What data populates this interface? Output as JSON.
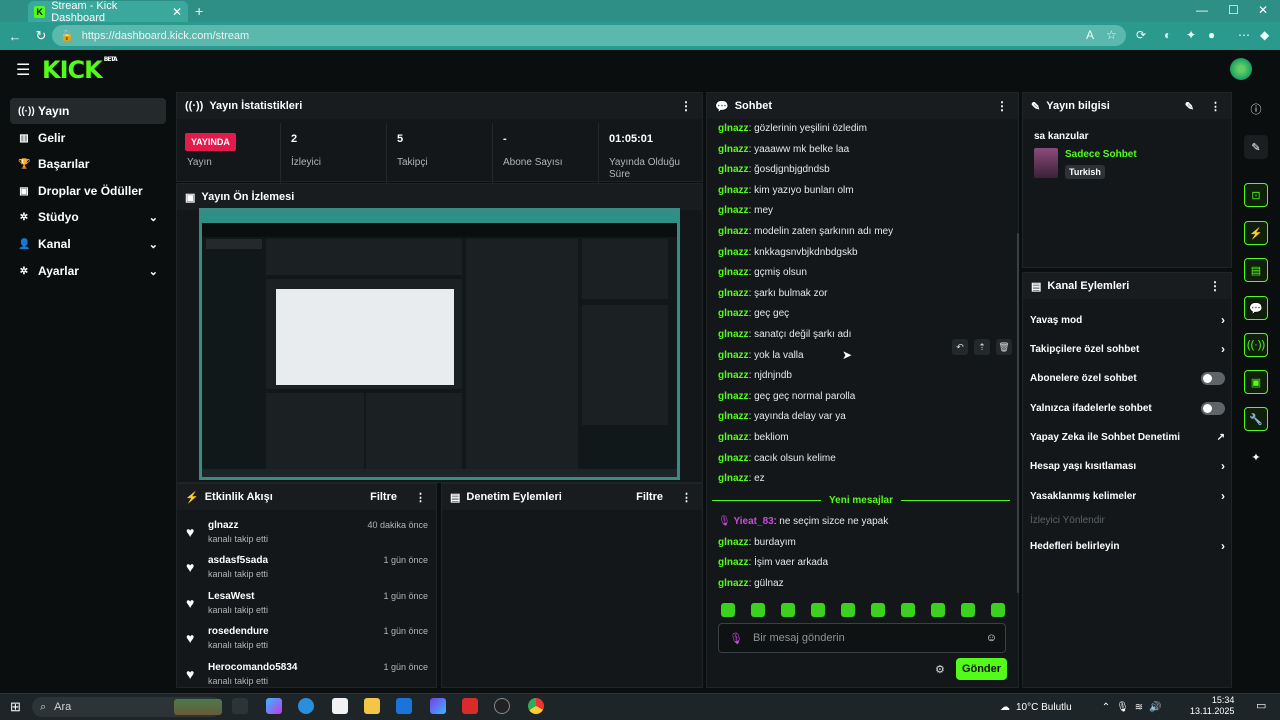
{
  "browser": {
    "tab_title": "Stream - Kick Dashboard",
    "url": "https://dashboard.kick.com/stream",
    "new_tab": "+",
    "win_min": "—",
    "win_max": "☐",
    "win_close": "✕"
  },
  "brand": {
    "logo": "KICK",
    "badge": "BETA"
  },
  "sidebar": {
    "items": [
      {
        "label": "Yayın",
        "icon": "broadcast-icon"
      },
      {
        "label": "Gelir",
        "icon": "chart-icon"
      },
      {
        "label": "Başarılar",
        "icon": "trophy-icon"
      },
      {
        "label": "Droplar ve Ödüller",
        "icon": "gift-icon"
      },
      {
        "label": "Stüdyo",
        "icon": "gear-icon"
      },
      {
        "label": "Kanal",
        "icon": "user-icon"
      },
      {
        "label": "Ayarlar",
        "icon": "gear-icon"
      }
    ]
  },
  "stats": {
    "title": "Yayın İstatistikleri",
    "live_badge": "YAYINDA",
    "live_label": "Yayın",
    "items": [
      {
        "value": "2",
        "label": "İzleyici"
      },
      {
        "value": "5",
        "label": "Takipçi"
      },
      {
        "value": "-",
        "label": "Abone Sayısı"
      },
      {
        "value": "01:05:01",
        "label": "Yayında Olduğu Süre"
      }
    ]
  },
  "preview": {
    "title": "Yayın Ön İzlemesi"
  },
  "activity": {
    "title": "Etkinlik Akışı",
    "filter": "Filtre",
    "items": [
      {
        "name": "glnazz",
        "sub": "kanalı takip etti",
        "time": "40 dakika önce"
      },
      {
        "name": "asdasf5sada",
        "sub": "kanalı takip etti",
        "time": "1 gün önce"
      },
      {
        "name": "LesaWest",
        "sub": "kanalı takip etti",
        "time": "1 gün önce"
      },
      {
        "name": "rosedendure",
        "sub": "kanalı takip etti",
        "time": "1 gün önce"
      },
      {
        "name": "Herocomando5834",
        "sub": "kanalı takip etti",
        "time": "1 gün önce"
      }
    ]
  },
  "moderation": {
    "title": "Denetim Eylemleri",
    "filter": "Filtre"
  },
  "chat": {
    "title": "Sohbet",
    "messages": [
      {
        "user": "glnazz",
        "text": "gözlerinin yeşilini özledim"
      },
      {
        "user": "glnazz",
        "text": "yaaaww mk belke laa"
      },
      {
        "user": "glnazz",
        "text": "ğosdjgnbjgdndsb"
      },
      {
        "user": "glnazz",
        "text": "kim yazıyo bunları olm"
      },
      {
        "user": "glnazz",
        "text": "mey"
      },
      {
        "user": "glnazz",
        "text": "modelin zaten şarkının adı mey"
      },
      {
        "user": "glnazz",
        "text": "knkkagsnvbjkdnbdgskb"
      },
      {
        "user": "glnazz",
        "text": "gçmiş olsun"
      },
      {
        "user": "glnazz",
        "text": "şarkı bulmak zor"
      },
      {
        "user": "glnazz",
        "text": "geç geç"
      },
      {
        "user": "glnazz",
        "text": "sanatçı değil şarkı adı"
      },
      {
        "user": "glnazz",
        "text": "yok la valla"
      },
      {
        "user": "glnazz",
        "text": "njdnjndb"
      },
      {
        "user": "glnazz",
        "text": "geç geç normal parolla"
      },
      {
        "user": "glnazz",
        "text": "yayında delay var ya"
      },
      {
        "user": "glnazz",
        "text": "bekliom"
      },
      {
        "user": "glnazz",
        "text": "cacık olsun kelime"
      },
      {
        "user": "glnazz",
        "text": "ez"
      }
    ],
    "new_messages_label": "Yeni mesajlar",
    "new_messages": [
      {
        "user": "Yieat_83",
        "text": "ne seçim sizce ne yapak",
        "highlight": true
      },
      {
        "user": "glnazz",
        "text": "burdayım"
      },
      {
        "user": "glnazz",
        "text": "İşim vaer arkada"
      },
      {
        "user": "glnazz",
        "text": "gülnaz"
      }
    ],
    "input_placeholder": "Bir mesaj gönderin",
    "send": "Gönder"
  },
  "stream_info": {
    "title": "Yayın bilgisi",
    "stream_title": "sa kanzular",
    "category": "Sadece Sohbet",
    "tag": "Turkish"
  },
  "channel_actions": {
    "title": "Kanal Eylemleri",
    "items": [
      {
        "label": "Yavaş mod",
        "kind": "chevron"
      },
      {
        "label": "Takipçilere özel sohbet",
        "kind": "chevron"
      },
      {
        "label": "Abonelere özel sohbet",
        "kind": "toggle"
      },
      {
        "label": "Yalnızca ifadelerle sohbet",
        "kind": "toggle"
      },
      {
        "label": "Yapay Zeka ile Sohbet Denetimi",
        "kind": "external"
      },
      {
        "label": "Hesap yaşı kısıtlaması",
        "kind": "chevron"
      },
      {
        "label": "Yasaklanmış kelimeler",
        "kind": "chevron"
      },
      {
        "label": "İzleyici Yönlendir",
        "kind": "disabled"
      },
      {
        "label": "Hedefleri belirleyin",
        "kind": "chevron"
      }
    ]
  },
  "taskbar": {
    "search": "Ara",
    "weather": "10°C Bulutlu",
    "time": "15:34",
    "date": "13.11.2025"
  },
  "colors": {
    "accent": "#53fc18",
    "live": "#e21b4d",
    "bg": "#0b0e0f",
    "panel": "#141719"
  }
}
